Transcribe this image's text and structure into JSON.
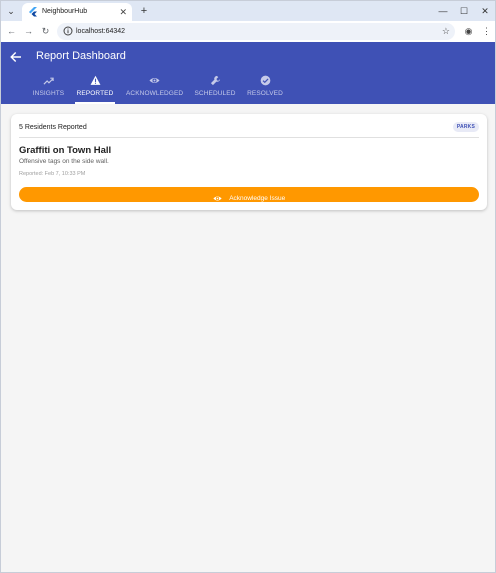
{
  "browser": {
    "tab_title": "NeighbourHub",
    "tab_close": "✕",
    "new_tab": "+",
    "dropdown": "⌄",
    "url": "localhost:64342",
    "window_controls": {
      "minimize": "—",
      "maximize": "☐",
      "close": "✕"
    },
    "nav": {
      "back": "←",
      "forward": "→",
      "reload": "↻"
    },
    "bookmark": "☆",
    "menu": "⋮",
    "profile": "◉"
  },
  "app": {
    "title": "Report Dashboard",
    "tabs": [
      {
        "label": "INSIGHTS",
        "icon": "trending-icon"
      },
      {
        "label": "REPORTED",
        "icon": "warning-icon"
      },
      {
        "label": "ACKNOWLEDGED",
        "icon": "eye-icon"
      },
      {
        "label": "SCHEDULED",
        "icon": "wrench-icon"
      },
      {
        "label": "RESOLVED",
        "icon": "check-circle-icon"
      }
    ],
    "active_tab": "REPORTED"
  },
  "report": {
    "residents": "5 Residents Reported",
    "category": "PARKS",
    "title": "Graffiti on Town Hall",
    "description": "Offensive tags on the side wall.",
    "reported": "Reported: Feb 7, 10:33 PM",
    "action_label": "Acknowledge Issue"
  },
  "colors": {
    "primary": "#3f51b5",
    "accent": "#ff9800",
    "background": "#f5f5f5"
  }
}
